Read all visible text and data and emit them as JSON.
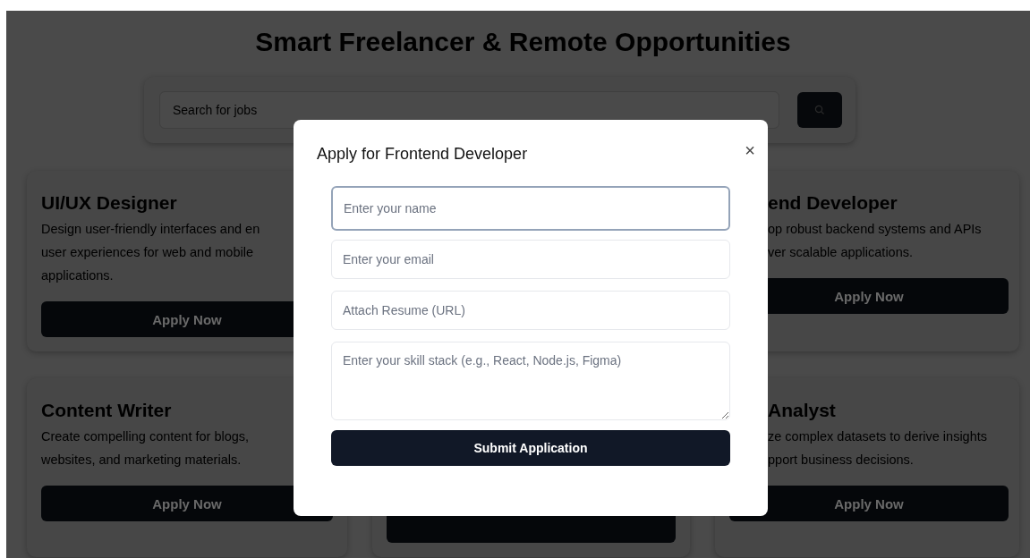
{
  "page_title": "Smart Freelancer & Remote Opportunities",
  "search": {
    "placeholder": "Search for jobs"
  },
  "cards": [
    {
      "kind": "left",
      "title": "UI/UX Designer",
      "lines": [
        "Design user-friendly interfaces and en",
        "user experiences for web and mobile",
        "applications."
      ],
      "button": "Apply Now"
    },
    {
      "kind": "hidden"
    },
    {
      "kind": "right",
      "title": "end Developer",
      "lines": [
        "op robust backend systems and APIs",
        "ver scalable applications."
      ],
      "button": "Apply Now"
    },
    {
      "kind": "left",
      "title": "Content Writer",
      "lines": [
        "Create compelling content for blogs,",
        "websites, and marketing materials."
      ],
      "button": "Apply Now"
    },
    {
      "kind": "middle",
      "button_visible": true
    },
    {
      "kind": "right",
      "title": "Analyst",
      "lines": [
        "ze complex datasets to derive insights",
        "pport business decisions."
      ],
      "button": "Apply Now"
    }
  ],
  "modal": {
    "title": "Apply for Frontend Developer",
    "close": "×",
    "fields": [
      {
        "kind": "input",
        "placeholder": "Enter your name",
        "focused": true
      },
      {
        "kind": "input",
        "placeholder": "Enter your email",
        "focused": false
      },
      {
        "kind": "input",
        "placeholder": "Attach Resume (URL)",
        "focused": false
      },
      {
        "kind": "textarea",
        "placeholder": "Enter your skill stack (e.g., React, Node.js, Figma)",
        "focused": false
      }
    ],
    "submit": "Submit Application"
  }
}
